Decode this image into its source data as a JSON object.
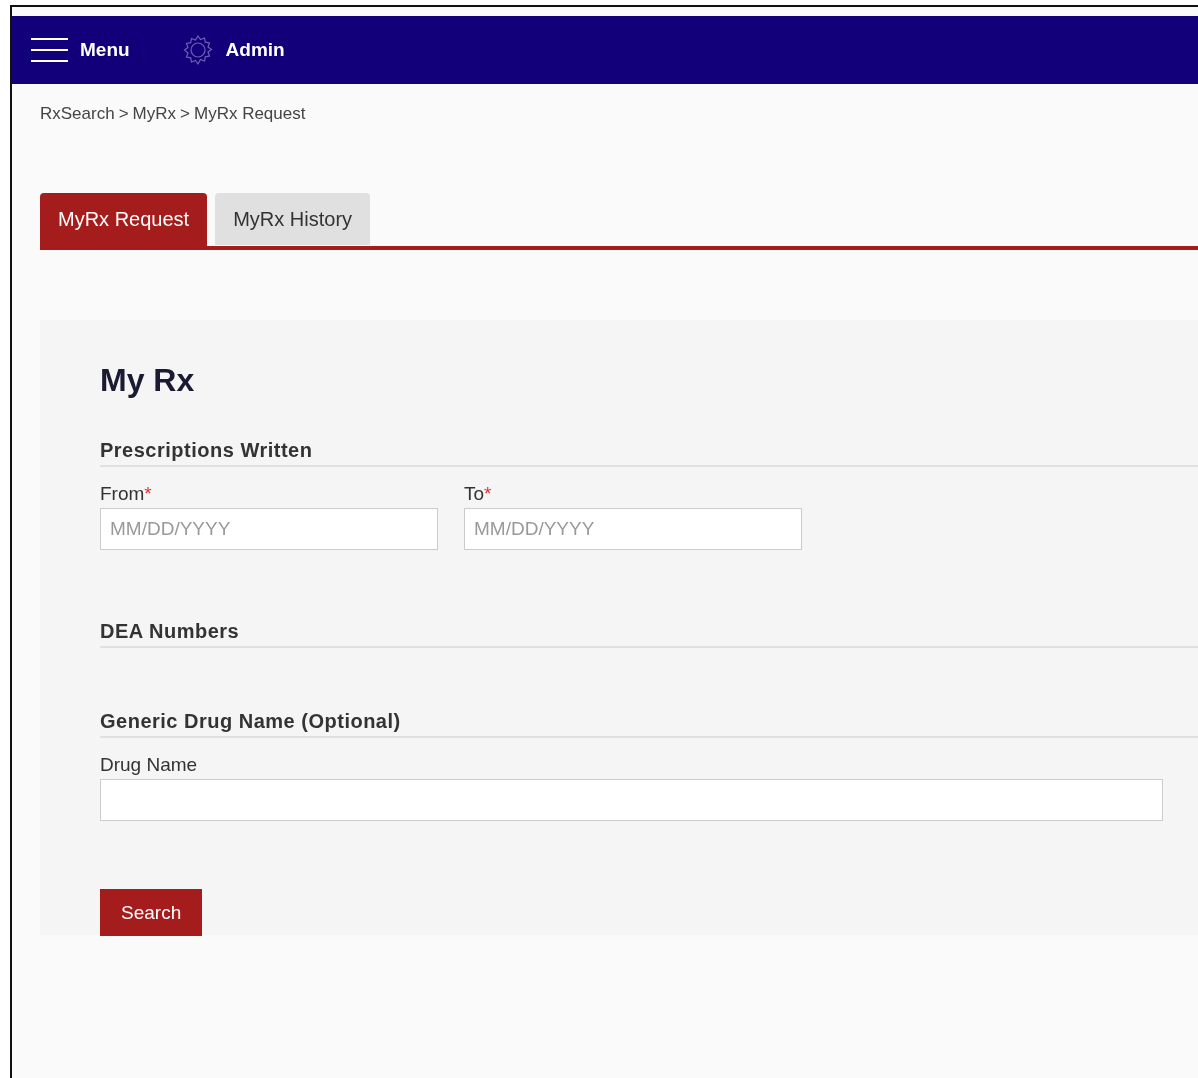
{
  "navbar": {
    "menu_label": "Menu",
    "admin_label": "Admin"
  },
  "breadcrumb": [
    "RxSearch",
    ">",
    "MyRx",
    ">",
    "MyRx Request"
  ],
  "tabs": [
    {
      "label": "MyRx Request",
      "selected": true
    },
    {
      "label": "MyRx History",
      "selected": false
    }
  ],
  "form": {
    "title": "My Rx",
    "sections": [
      {
        "heading": "Prescriptions Written",
        "kind": "date-range",
        "fields": [
          {
            "label": "From",
            "required_mark": "*",
            "placeholder": "MM/DD/YYYY"
          },
          {
            "label": "To",
            "required_mark": "*",
            "placeholder": "MM/DD/YYYY"
          }
        ]
      },
      {
        "heading": "DEA Numbers",
        "kind": "empty"
      },
      {
        "heading": "Generic Drug Name (Optional)",
        "kind": "text",
        "fields": [
          {
            "label": "Drug Name"
          }
        ]
      }
    ],
    "submit": "Search"
  }
}
